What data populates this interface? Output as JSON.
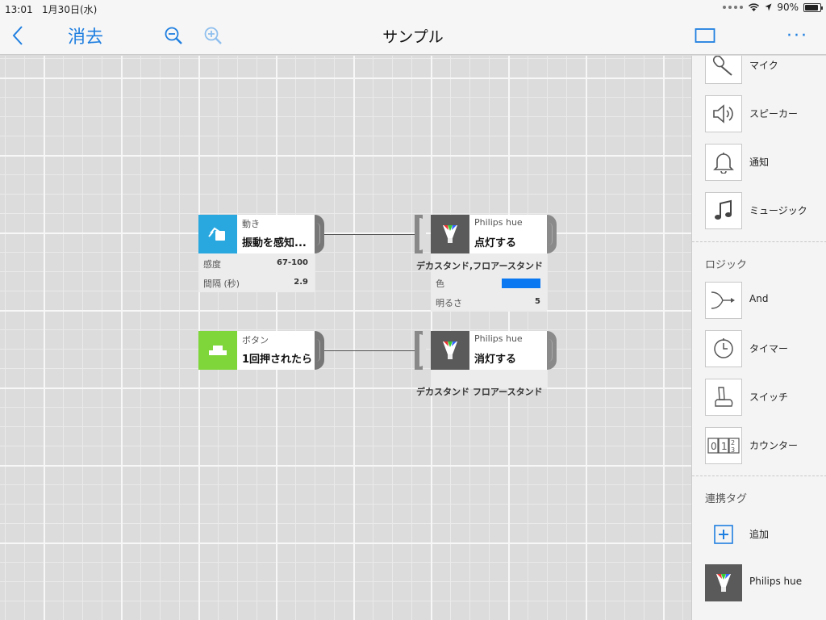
{
  "status": {
    "time": "13:01",
    "date": "1月30日(水)",
    "battery": "90%",
    "battery_level": 0.9
  },
  "nav": {
    "back_icon": "chevron-left-icon",
    "clear_label": "消去",
    "title": "サンプル",
    "more_label": "···"
  },
  "blocks": {
    "motion": {
      "category": "動き",
      "name": "振動を感知...",
      "params": [
        {
          "key": "感度",
          "value": "67-100"
        },
        {
          "key": "間隔 (秒)",
          "value": "2.9"
        }
      ],
      "color": "#29a8e0"
    },
    "hue_on": {
      "category": "Philips hue",
      "name": "点灯する",
      "device": "デカスタンド,フロアースタンド",
      "params": [
        {
          "key": "色",
          "color": "#0a78f0"
        },
        {
          "key": "明るさ",
          "value": "5"
        }
      ]
    },
    "button": {
      "category": "ボタン",
      "name": "1回押されたら",
      "color": "#7ed63a"
    },
    "hue_off": {
      "category": "Philips hue",
      "name": "消灯する",
      "device": "デカスタンド フロアースタンド"
    }
  },
  "sidebar": {
    "items": [
      {
        "label": "マイク",
        "icon": "microphone-icon"
      },
      {
        "label": "スピーカー",
        "icon": "speaker-icon"
      },
      {
        "label": "通知",
        "icon": "bell-icon"
      },
      {
        "label": "ミュージック",
        "icon": "music-note-icon"
      }
    ],
    "logic_title": "ロジック",
    "logic_items": [
      {
        "label": "And",
        "icon": "and-merge-icon"
      },
      {
        "label": "タイマー",
        "icon": "timer-icon"
      },
      {
        "label": "スイッチ",
        "icon": "switch-lever-icon"
      },
      {
        "label": "カウンター",
        "icon": "counter-icon"
      }
    ],
    "tags_title": "連携タグ",
    "add_label": "追加",
    "hue_label": "Philips hue"
  }
}
